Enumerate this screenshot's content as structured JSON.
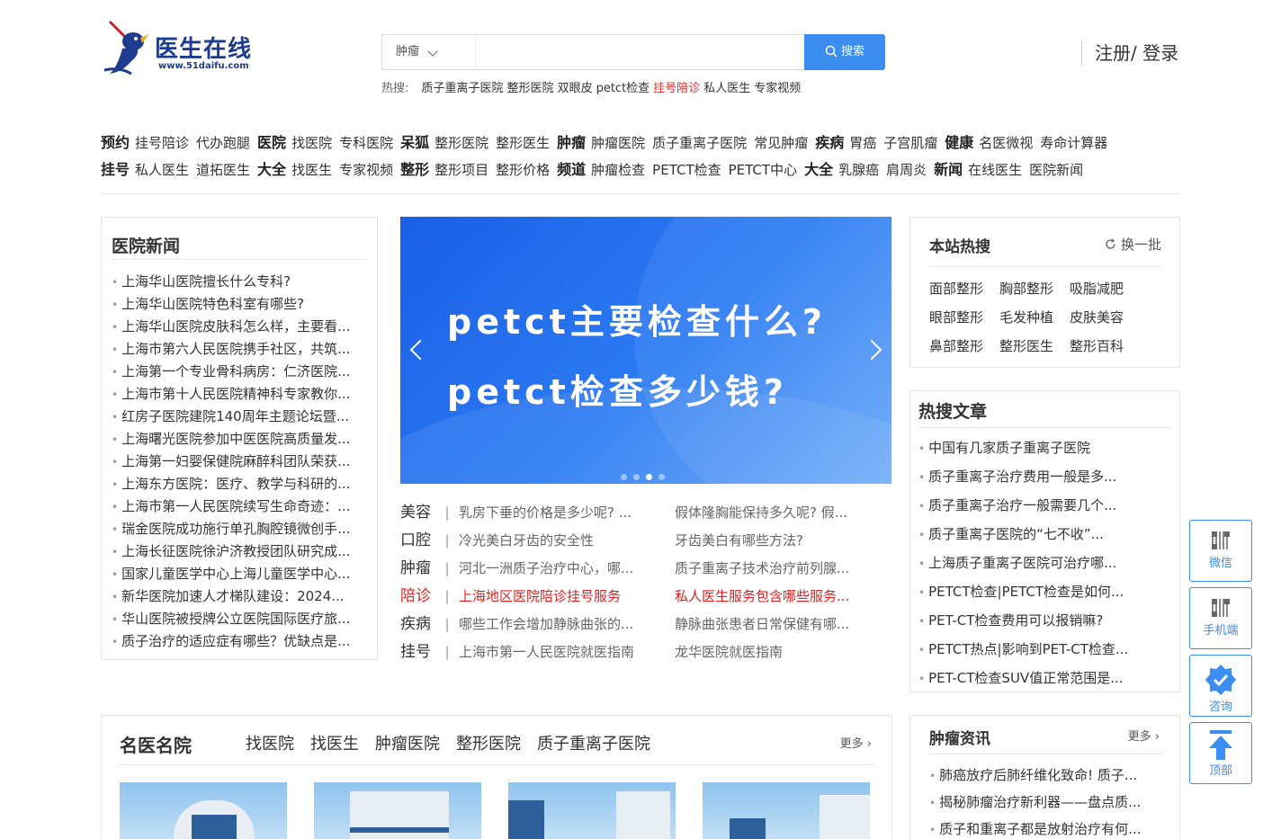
{
  "header": {
    "logo_text": "医生在线",
    "logo_url": "www.51daifu.com",
    "search": {
      "selected_category": "肿瘤",
      "placeholder": "",
      "button_label": "搜索"
    },
    "hot_search": {
      "label": "热搜:",
      "items": [
        {
          "text": "质子重离子医院",
          "red": false
        },
        {
          "text": "整形医院",
          "red": false
        },
        {
          "text": "双眼皮",
          "red": false
        },
        {
          "text": "petct检查",
          "red": false
        },
        {
          "text": "挂号陪诊",
          "red": true
        },
        {
          "text": "私人医生",
          "red": false
        },
        {
          "text": "专家视频",
          "red": false
        }
      ]
    },
    "login_label": "注册/ 登录"
  },
  "nav": {
    "row1": [
      {
        "head": "预约",
        "items": [
          "挂号陪诊",
          "代办跑腿"
        ]
      },
      {
        "head": "医院",
        "items": [
          "找医院",
          "专科医院"
        ]
      },
      {
        "head": "呆狐",
        "items": [
          "整形医院",
          "整形医生"
        ]
      },
      {
        "head": "肿瘤",
        "items": [
          "肿瘤医院",
          "质子重离子医院",
          "常见肿瘤"
        ]
      },
      {
        "head": "疾病",
        "items": [
          "胃癌",
          "子宫肌瘤"
        ]
      },
      {
        "head": "健康",
        "items": [
          "名医微视",
          "寿命计算器"
        ]
      }
    ],
    "row2": [
      {
        "head": "挂号",
        "items": [
          "私人医生",
          "道拓医生"
        ]
      },
      {
        "head": "大全",
        "items": [
          "找医生",
          "专家视频"
        ]
      },
      {
        "head": "整形",
        "items": [
          "整形项目",
          "整形价格"
        ]
      },
      {
        "head": "频道",
        "items": [
          "肿瘤检查",
          "PETCT检查",
          "PETCT中心"
        ]
      },
      {
        "head": "大全",
        "items": [
          "乳腺癌",
          "肩周炎"
        ]
      },
      {
        "head": "新闻",
        "items": [
          "在线医生",
          "医院新闻"
        ]
      }
    ]
  },
  "hospital_news": {
    "title": "医院新闻",
    "items": [
      "上海华山医院擅长什么专科?",
      "上海华山医院特色科室有哪些?",
      "上海华山医院皮肤科怎么样，主要看...",
      "上海市第六人民医院携手社区，共筑...",
      "上海第一个专业骨科病房：仁济医院...",
      "上海市第十人民医院精神科专家教你...",
      "红房子医院建院140周年主题论坛暨...",
      "上海曙光医院参加中医医院高质量发...",
      "上海第一妇婴保健院麻醉科团队荣获...",
      "上海东方医院：医疗、教学与科研的...",
      "上海市第一人民医院续写生命奇迹：...",
      "瑞金医院成功施行单孔胸腔镜微创手...",
      "上海长征医院徐沪济教授团队研究成...",
      "国家儿童医学中心上海儿童医学中心...",
      "新华医院加速人才梯队建设：2024...",
      "华山医院被授牌公立医院国际医疗旅...",
      "质子治疗的适应症有哪些？优缺点是..."
    ]
  },
  "banner": {
    "line1": "petct主要检查什么?",
    "line2": "petct检查多少钱?",
    "active_slide": 3,
    "slide_count": 4
  },
  "categories": [
    {
      "cat": "美容",
      "a": "乳房下垂的价格是多少呢? ...",
      "b": "假体隆胸能保持多久呢? 假...",
      "red": false
    },
    {
      "cat": "口腔",
      "a": "冷光美白牙齿的安全性",
      "b": "牙齿美白有哪些方法?",
      "red": false
    },
    {
      "cat": "肿瘤",
      "a": "河北一洲质子治疗中心，哪...",
      "b": "质子重离子技术治疗前列腺...",
      "red": false
    },
    {
      "cat": "陪诊",
      "a": "上海地区医院陪诊挂号服务",
      "b": "私人医生服务包含哪些服务...",
      "red": true
    },
    {
      "cat": "疾病",
      "a": "哪些工作会增加静脉曲张的...",
      "b": "静脉曲张患者日常保健有哪...",
      "red": false
    },
    {
      "cat": "挂号",
      "a": "上海市第一人民医院就医指南",
      "b": "龙华医院就医指南",
      "red": false
    }
  ],
  "hot_panel": {
    "title": "本站热搜",
    "refresh_label": "换一批",
    "tags": [
      "面部整形",
      "胸部整形",
      "吸脂减肥",
      "眼部整形",
      "毛发种植",
      "皮肤美容",
      "鼻部整形",
      "整形医生",
      "整形百科"
    ]
  },
  "hot_articles": {
    "title": "热搜文章",
    "items": [
      "中国有几家质子重离子医院",
      "质子重离子治疗费用一般是多...",
      "质子重离子治疗一般需要几个...",
      "质子重离子医院的“七不收”...",
      "上海质子重离子医院可治疗哪...",
      "PETCT检查|PETCT检查是如何...",
      "PET-CT检查费用可以报销嘛?",
      "PETCT热点|影响到PET-CT检查...",
      "PET-CT检查SUV值正常范围是..."
    ]
  },
  "famous": {
    "title": "名医名院",
    "tabs": [
      "找医院",
      "找医生",
      "肿瘤医院",
      "整形医院",
      "质子重离子医院"
    ],
    "more_label": "更多"
  },
  "tumor_news": {
    "title": "肿瘤资讯",
    "more_label": "更多",
    "items": [
      "肺癌放疗后肺纤维化致命! 质子...",
      "揭秘肺瘤治疗新利器——盘点质...",
      "质子和重离子都是放射治疗有何..."
    ]
  },
  "side_float": {
    "wechat": "微信",
    "mobile": "手机端",
    "consult": "咨询",
    "top": "顶部"
  },
  "colors": {
    "accent": "#3b8df0",
    "red": "#e02020",
    "banner": "#1a5fe6"
  }
}
